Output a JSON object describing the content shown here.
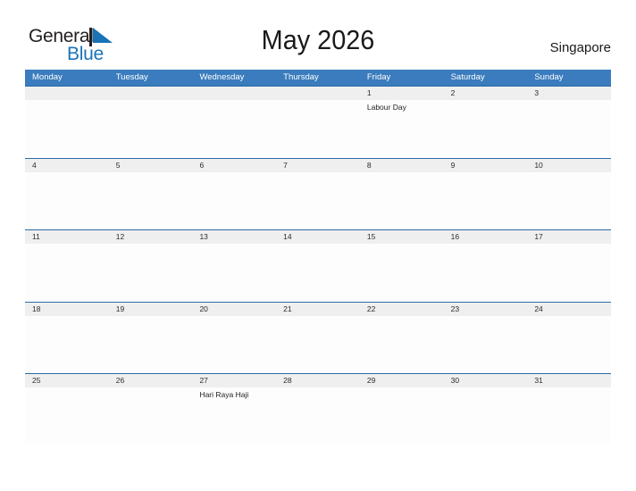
{
  "brand": {
    "name_part1": "General",
    "name_part2": "Blue",
    "flag_icon": "triangle-flag-icon",
    "accent_color": "#1a73b7",
    "text_color": "#231f20"
  },
  "header": {
    "title": "May 2026",
    "locale": "Singapore"
  },
  "calendar": {
    "header_bg_color": "#3a7cbd",
    "date_band_color": "#efefef",
    "rule_color": "#2d6ca8",
    "day_names": [
      "Monday",
      "Tuesday",
      "Wednesday",
      "Thursday",
      "Friday",
      "Saturday",
      "Sunday"
    ],
    "weeks": [
      {
        "days": [
          {
            "num": "",
            "event": ""
          },
          {
            "num": "",
            "event": ""
          },
          {
            "num": "",
            "event": ""
          },
          {
            "num": "",
            "event": ""
          },
          {
            "num": "1",
            "event": "Labour Day"
          },
          {
            "num": "2",
            "event": ""
          },
          {
            "num": "3",
            "event": ""
          }
        ]
      },
      {
        "days": [
          {
            "num": "4",
            "event": ""
          },
          {
            "num": "5",
            "event": ""
          },
          {
            "num": "6",
            "event": ""
          },
          {
            "num": "7",
            "event": ""
          },
          {
            "num": "8",
            "event": ""
          },
          {
            "num": "9",
            "event": ""
          },
          {
            "num": "10",
            "event": ""
          }
        ]
      },
      {
        "days": [
          {
            "num": "11",
            "event": ""
          },
          {
            "num": "12",
            "event": ""
          },
          {
            "num": "13",
            "event": ""
          },
          {
            "num": "14",
            "event": ""
          },
          {
            "num": "15",
            "event": ""
          },
          {
            "num": "16",
            "event": ""
          },
          {
            "num": "17",
            "event": ""
          }
        ]
      },
      {
        "days": [
          {
            "num": "18",
            "event": ""
          },
          {
            "num": "19",
            "event": ""
          },
          {
            "num": "20",
            "event": ""
          },
          {
            "num": "21",
            "event": ""
          },
          {
            "num": "22",
            "event": ""
          },
          {
            "num": "23",
            "event": ""
          },
          {
            "num": "24",
            "event": ""
          }
        ]
      },
      {
        "days": [
          {
            "num": "25",
            "event": ""
          },
          {
            "num": "26",
            "event": ""
          },
          {
            "num": "27",
            "event": "Hari Raya Haji"
          },
          {
            "num": "28",
            "event": ""
          },
          {
            "num": "29",
            "event": ""
          },
          {
            "num": "30",
            "event": ""
          },
          {
            "num": "31",
            "event": ""
          }
        ]
      }
    ]
  }
}
